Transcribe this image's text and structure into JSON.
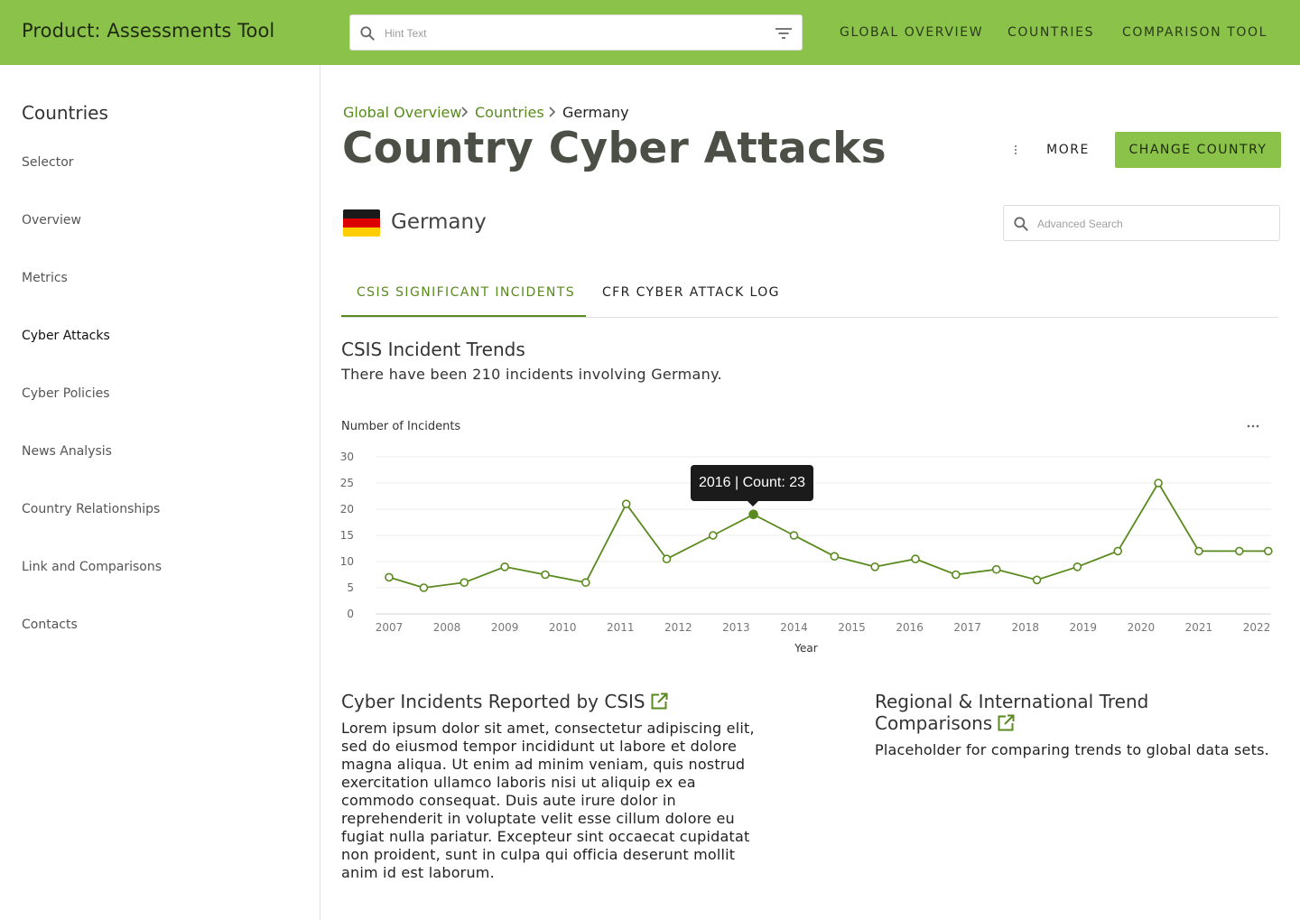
{
  "header": {
    "app_title": "Product: Assessments Tool",
    "search_placeholder": "Hint Text",
    "nav": [
      "GLOBAL OVERVIEW",
      "COUNTRIES",
      "COMPARISON TOOL"
    ]
  },
  "sidebar": {
    "title": "Countries",
    "items": [
      {
        "label": "Selector"
      },
      {
        "label": "Overview"
      },
      {
        "label": "Metrics"
      },
      {
        "label": "Cyber Attacks",
        "active": true
      },
      {
        "label": "Cyber Policies"
      },
      {
        "label": "News Analysis"
      },
      {
        "label": "Country Relationships"
      },
      {
        "label": "Link and Comparisons"
      },
      {
        "label": "Contacts"
      }
    ]
  },
  "breadcrumb": [
    "Global Overview",
    "Countries",
    "Germany"
  ],
  "page": {
    "title": "Country Cyber Attacks",
    "more_label": "MORE",
    "change_country_label": "CHANGE COUNTRY",
    "country": "Germany",
    "flag_colors": [
      "#1a1a1a",
      "#dd0000",
      "#ffce00"
    ],
    "advanced_search_placeholder": "Advanced Search"
  },
  "tabs": [
    {
      "label": "CSIS SIGNIFICANT INCIDENTS",
      "active": true
    },
    {
      "label": "CFR CYBER ATTACK LOG",
      "active": false
    }
  ],
  "trends": {
    "title": "CSIS Incident Trends",
    "description": "There have been 210 incidents involving Germany."
  },
  "chart_data": {
    "type": "line",
    "ylabel": "Number of Incidents",
    "xlabel": "Year",
    "x_ticks": [
      "2007",
      "2008",
      "2009",
      "2010",
      "2011",
      "2012",
      "2013",
      "2014",
      "2015",
      "2016",
      "2017",
      "2018",
      "2019",
      "2020",
      "2021",
      "2022"
    ],
    "y_ticks": [
      "30",
      "25",
      "20",
      "15",
      "10",
      "5",
      "0"
    ],
    "ylim": [
      0,
      30
    ],
    "grid": true,
    "color": "#5a8a1f",
    "points": [
      {
        "x": 2007.0,
        "y": 7
      },
      {
        "x": 2007.6,
        "y": 5
      },
      {
        "x": 2008.3,
        "y": 6
      },
      {
        "x": 2009.0,
        "y": 9
      },
      {
        "x": 2009.7,
        "y": 7.5
      },
      {
        "x": 2010.4,
        "y": 6
      },
      {
        "x": 2011.1,
        "y": 21
      },
      {
        "x": 2011.8,
        "y": 10.5
      },
      {
        "x": 2012.6,
        "y": 15
      },
      {
        "x": 2013.3,
        "y": 19
      },
      {
        "x": 2014.0,
        "y": 15
      },
      {
        "x": 2014.7,
        "y": 11
      },
      {
        "x": 2015.4,
        "y": 9
      },
      {
        "x": 2016.1,
        "y": 10.5
      },
      {
        "x": 2016.8,
        "y": 7.5
      },
      {
        "x": 2017.5,
        "y": 8.5
      },
      {
        "x": 2018.2,
        "y": 6.5
      },
      {
        "x": 2018.9,
        "y": 9
      },
      {
        "x": 2019.6,
        "y": 12
      },
      {
        "x": 2020.3,
        "y": 25
      },
      {
        "x": 2021.0,
        "y": 12
      },
      {
        "x": 2021.7,
        "y": 12
      },
      {
        "x": 2022.2,
        "y": 12
      }
    ],
    "highlight_index": 9,
    "tooltip": "2016 | Count: 23"
  },
  "sections": {
    "csis_title": "Cyber Incidents Reported by CSIS",
    "csis_body": "Lorem ipsum dolor sit amet, consectetur adipiscing elit, sed do eiusmod tempor incididunt ut labore et dolore magna aliqua. Ut enim ad minim veniam, quis nostrud exercitation ullamco laboris nisi ut aliquip ex ea commodo consequat. Duis aute irure dolor in reprehenderit in voluptate velit esse cillum dolore eu fugiat nulla pariatur. Excepteur sint occaecat cupidatat non proident, sunt in culpa qui officia deserunt mollit anim id est laborum.",
    "regional_title": "Regional & International Trend Comparisons",
    "regional_body": "Placeholder for comparing trends to global data sets."
  },
  "icons": [
    "search-icon",
    "filter-icon",
    "chevron-right-icon",
    "more-vert-icon",
    "more-horiz-icon",
    "open-in-new-icon"
  ]
}
